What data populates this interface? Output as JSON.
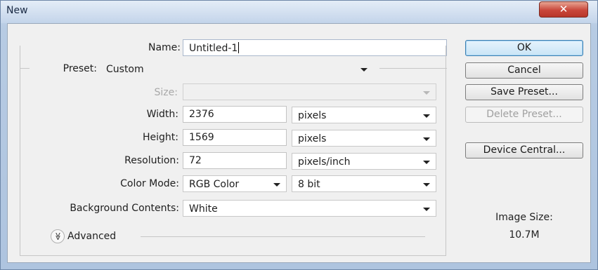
{
  "window": {
    "title": "New",
    "close_glyph": "✕"
  },
  "form": {
    "name_label": "Name:",
    "name_value": "Untitled-1",
    "preset_label": "Preset:",
    "preset_value": "Custom",
    "size_label": "Size:",
    "size_value": "",
    "width_label": "Width:",
    "width_value": "2376",
    "width_unit": "pixels",
    "height_label": "Height:",
    "height_value": "1569",
    "height_unit": "pixels",
    "resolution_label": "Resolution:",
    "resolution_value": "72",
    "resolution_unit": "pixels/inch",
    "color_mode_label": "Color Mode:",
    "color_mode_value": "RGB Color",
    "bit_depth_value": "8 bit",
    "background_label": "Background Contents:",
    "background_value": "White",
    "advanced_label": "Advanced",
    "advanced_glyph": "≫"
  },
  "buttons": {
    "ok": "OK",
    "cancel": "Cancel",
    "save_preset": "Save Preset...",
    "delete_preset": "Delete Preset...",
    "device_central": "Device Central..."
  },
  "info": {
    "image_size_label": "Image Size:",
    "image_size_value": "10.7M"
  },
  "icons": {
    "close": "close-icon",
    "advanced": "chevron-double-down-icon",
    "dropdown": "chevron-down-icon"
  }
}
